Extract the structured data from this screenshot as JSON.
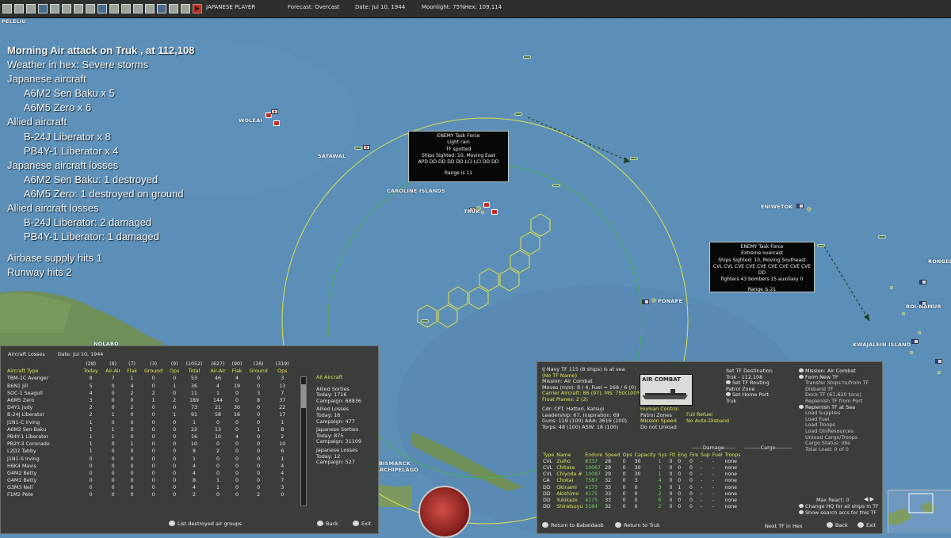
{
  "toolbar": {
    "player": "JAPANESE PLAYER",
    "forecast": "Forecast: Overcast",
    "date": "Date: Jul 10, 1944",
    "moonlight": "Moonlight: 75%",
    "hex": "Hex: 109,114",
    "icons": [
      "save-icon",
      "file-icon",
      "fleet-icon",
      "base-icon",
      "air-icon",
      "ground-icon",
      "intel-icon",
      "report-icon",
      "ship-icon",
      "map-icon",
      "target-icon",
      "filter-icon",
      "weather-icon",
      "grid-icon",
      "zoom-icon",
      "help-icon",
      "end-turn-icon"
    ]
  },
  "report": {
    "title": "Morning Air attack on Truk , at 112,108",
    "weather": "Weather in hex: Severe storms",
    "jap_aircraft_head": "Japanese aircraft",
    "jap_aircraft": [
      "A6M2 Sen Baku x 5",
      "A6M5 Zero x 6"
    ],
    "allied_aircraft_head": "Allied aircraft",
    "allied_aircraft": [
      "B-24J Liberator x 8",
      "PB4Y-1 Liberator x 4"
    ],
    "jap_losses_head": "Japanese aircraft losses",
    "jap_losses": [
      "A6M2 Sen Baku: 1 destroyed",
      "A6M5 Zero: 1 destroyed on ground"
    ],
    "allied_losses_head": "Allied aircraft losses",
    "allied_losses": [
      "B-24J Liberator: 2 damaged",
      "PB4Y-1 Liberator: 1 damaged"
    ],
    "supply_hits": "Airbase supply hits 1",
    "runway_hits": "Runway hits 2"
  },
  "map_labels": {
    "peleliu": "PELELIU",
    "woleai": "WOLEAI",
    "satawal": "SATAWAL",
    "caroline": "CAROLINE ISLANDS",
    "truk": "TRUK",
    "eniwetok": "ENIWETOK",
    "ponape": "PONAPE",
    "rongelap": "RONGELA",
    "roi_namur": "ROI-NAMUR",
    "kwajalein": "KWAJALEIN ISLAND",
    "bismarck": "BISMARCK",
    "archipelago": "ARCHIPELAGO",
    "rabaul_area": "NOLABO"
  },
  "enemy_tf1": {
    "lines": [
      "ENEMY Task Force",
      "Light rain",
      "TF spotted",
      "Ships Sighted: 10, Moving East",
      "APD DD DD DD DD LCI LCI DD DD"
    ],
    "range": "Range is 11"
  },
  "enemy_tf2": {
    "lines": [
      "ENEMY Task Force",
      "Extreme overcast",
      "Ships Sighted: 10, Moving Southeast",
      "CVL CVL CVE CVE CVE CVE CVE CVE CVE DD",
      "fighters 43  bombers 15  auxiliary 0"
    ],
    "range": "Range is 21"
  },
  "aircraft_losses": {
    "title": "Aircraft Losses",
    "date": "Date: Jul 10, 1944",
    "header_top": [
      "(28)",
      "(9)",
      "(7)",
      "(3)",
      "(9)",
      "(1052)",
      "(627)",
      "(90)",
      "(16)",
      "(319)"
    ],
    "header": [
      "Aircraft Type",
      "Today",
      "Air-Air",
      "Flak",
      "Ground",
      "Ops",
      "Total",
      "Air-Air",
      "Flak",
      "Ground",
      "Ops"
    ],
    "rows": [
      [
        "TBM-1C Avenger",
        "8",
        "7",
        "1",
        "0",
        "0",
        "53",
        "46",
        "4",
        "0",
        "3"
      ],
      [
        "B6N1 Jill",
        "5",
        "0",
        "4",
        "0",
        "1",
        "36",
        "4",
        "19",
        "0",
        "13"
      ],
      [
        "SOC-1 Seagull",
        "4",
        "0",
        "2",
        "2",
        "0",
        "11",
        "1",
        "0",
        "3",
        "7"
      ],
      [
        "A6M5 Zero",
        "3",
        "0",
        "0",
        "1",
        "2",
        "189",
        "144",
        "0",
        "8",
        "37"
      ],
      [
        "D4Y1 Judy",
        "2",
        "0",
        "2",
        "0",
        "0",
        "73",
        "21",
        "30",
        "0",
        "22"
      ],
      [
        "B-24J Liberator",
        "2",
        "1",
        "0",
        "0",
        "1",
        "91",
        "58",
        "16",
        "0",
        "17"
      ],
      [
        "J1N1-C Irving",
        "1",
        "0",
        "0",
        "0",
        "0",
        "1",
        "0",
        "0",
        "0",
        "1"
      ],
      [
        "A6M2 Sen Baku",
        "1",
        "1",
        "0",
        "0",
        "0",
        "22",
        "13",
        "0",
        "1",
        "8"
      ],
      [
        "PB4Y-1 Liberator",
        "1",
        "1",
        "0",
        "0",
        "0",
        "16",
        "10",
        "4",
        "0",
        "2"
      ],
      [
        "PB2Y-3 Coronado",
        "1",
        "0",
        "1",
        "0",
        "0",
        "10",
        "0",
        "0",
        "0",
        "10"
      ],
      [
        "L2D2 Tabby",
        "1",
        "0",
        "0",
        "0",
        "0",
        "8",
        "2",
        "0",
        "0",
        "6"
      ],
      [
        "J1N1-S Irving",
        "0",
        "0",
        "0",
        "0",
        "0",
        "1",
        "0",
        "0",
        "0",
        "1"
      ],
      [
        "H6K4 Mavis",
        "0",
        "0",
        "0",
        "0",
        "0",
        "4",
        "0",
        "0",
        "0",
        "4"
      ],
      [
        "G4M2 Betty",
        "0",
        "0",
        "0",
        "0",
        "0",
        "4",
        "0",
        "0",
        "0",
        "4"
      ],
      [
        "G4M1 Betty",
        "0",
        "0",
        "0",
        "0",
        "0",
        "8",
        "1",
        "0",
        "0",
        "7"
      ],
      [
        "G3M3 Nell",
        "0",
        "0",
        "0",
        "0",
        "0",
        "4",
        "1",
        "0",
        "0",
        "3"
      ],
      [
        "F1M2 Pete",
        "0",
        "0",
        "0",
        "0",
        "0",
        "2",
        "0",
        "0",
        "2",
        "0"
      ]
    ],
    "summary": {
      "all": "All Aircraft",
      "allied_sorties": "Allied Sorties",
      "allied_sorties_today": "Today:  1716",
      "allied_sorties_campaign": "Campaign: 68836",
      "allied_losses": "Allied Losses",
      "allied_losses_today": "Today:  16",
      "allied_losses_campaign": "Campaign: 477",
      "jap_sorties": "Japanese Sorties",
      "jap_sorties_today": "Today:  875",
      "jap_sorties_campaign": "Campaign: 31109",
      "jap_losses": "Japanese Losses",
      "jap_losses_today": "Today:  12",
      "jap_losses_campaign": "Campaign: 527"
    },
    "list_destroyed": "List destroyed air groups",
    "back": "Back",
    "exit": "Exit"
  },
  "task_force": {
    "lines": [
      "IJ Navy TF 115 (8 ships) is at sea",
      "(No TF Name)",
      "Mission: Air Combat",
      "Moves (m/o): 8 / 4, Fuel = 168 / 6 (0)",
      "Carrier Aircraft: 86 (97),  MS: 750(100%)",
      "Float Planes: 2 (2)",
      "",
      "Cdr: CPT. Hattori, Katsuji",
      "Leadership: 67, Inspiration: 69",
      "Guns: 119 (100)  AAA: 3616 (100)",
      "Torps: 48 (100)  ASW: 18 (100)"
    ],
    "ship_image_label": "AIR COMBAT",
    "set_dest": "Set TF Destination",
    "dest": "Truk - 112,108",
    "set_routing": "Set TF Routing",
    "patrol_zone": "Patrol Zone",
    "set_home_port": "Set Home Port",
    "home": "Truk",
    "human_control": "Human Control",
    "patrol_zones": "Patrol Zones",
    "mission_speed": "Mission Speed",
    "do_not_unload": "Do not Unload",
    "full_refuel": "Full Refuel",
    "no_auto_disband": "No Auto-Disband",
    "damage_head": "------Damage------",
    "cargo_head": "---------Cargo---------",
    "ship_header": [
      "Type",
      "Name",
      "Endure",
      "Speed",
      "Ops",
      "Capacity",
      "Sys",
      "Flt",
      "Eng",
      "Fire",
      "Sup",
      "Fuel",
      "Troops"
    ],
    "ships": [
      [
        "CVL",
        "Zuiho",
        "8337",
        "28",
        "0",
        "30",
        "1",
        "0",
        "0",
        "0",
        "-",
        "-",
        "none"
      ],
      [
        "CVL",
        "Chitose",
        "10067",
        "29",
        "0",
        "30",
        "1",
        "0",
        "0",
        "0",
        "-",
        "-",
        "none"
      ],
      [
        "CVL",
        "Chiyoda #",
        "10087",
        "29",
        "0",
        "30",
        "1",
        "0",
        "0",
        "0",
        "-",
        "-",
        "none"
      ],
      [
        "CA",
        "Chokai",
        "7587",
        "32",
        "0",
        "3",
        "4",
        "0",
        "0",
        "0",
        "-",
        "-",
        "none"
      ],
      [
        "DD",
        "Okinami",
        "4175",
        "33",
        "0",
        "0",
        "3",
        "0",
        "1",
        "0",
        "-",
        "-",
        "none"
      ],
      [
        "DD",
        "Akishimo",
        "4175",
        "33",
        "0",
        "0",
        "2",
        "0",
        "0",
        "0",
        "-",
        "-",
        "none"
      ],
      [
        "DD",
        "Yukikaze",
        "4175",
        "33",
        "0",
        "0",
        "6",
        "0",
        "0",
        "0",
        "-",
        "-",
        "none"
      ],
      [
        "DD",
        "Shiratsuyu",
        "5184",
        "32",
        "0",
        "0",
        "2",
        "0",
        "0",
        "0",
        "-",
        "-",
        "none"
      ]
    ],
    "commands": [
      "Mission: Air Combat",
      "Form New TF",
      "Transfer Ships to/from TF",
      "Disband TF",
      "Dock TF (61,620 tons)",
      "Replenish TF from Port",
      "Replenish TF at Sea",
      "Load Supplies",
      "Load Fuel",
      "Load Troops",
      "Load Oil/Resources",
      "Unload Cargo/Troops",
      "Cargo Status: Idle",
      "Total Load: 0 of 0"
    ],
    "max_react": "Max React: 0",
    "change_hq": "Change HQ for all ships in TF",
    "show_search": "Show search arcs for this TF",
    "return_babeldaob": "Return to Babeldaob",
    "return_truk": "Return to Truk",
    "next_tf": "Next TF in Hex",
    "back": "Back",
    "exit": "Exit"
  }
}
